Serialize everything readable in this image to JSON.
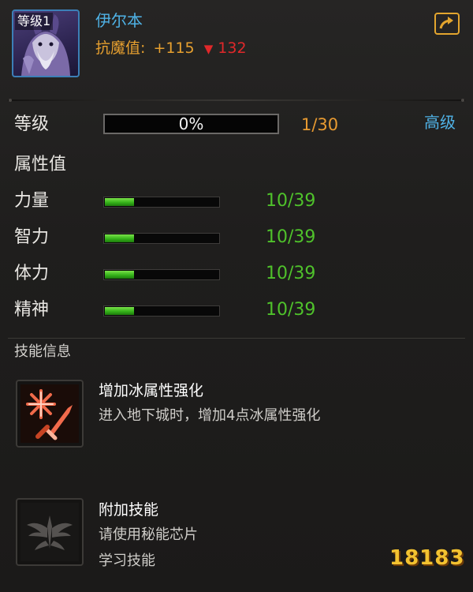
{
  "header": {
    "portrait_level": "等级1",
    "name": "伊尔本",
    "resist_label": "抗魔值:",
    "resist_plus": "+115",
    "resist_arrow": "▼",
    "resist_minus": "132",
    "export_icon": "share-export-icon"
  },
  "level": {
    "label": "等级",
    "percent_text": "0%",
    "progress": 0,
    "count": "1/30",
    "grade": "高级"
  },
  "attributes": {
    "title": "属性值",
    "items": [
      {
        "label": "力量",
        "value": "10/39",
        "fill": 0.256
      },
      {
        "label": "智力",
        "value": "10/39",
        "fill": 0.256
      },
      {
        "label": "体力",
        "value": "10/39",
        "fill": 0.256
      },
      {
        "label": "精神",
        "value": "10/39",
        "fill": 0.256
      }
    ]
  },
  "skills": {
    "title": "技能信息",
    "items": [
      {
        "icon": "ice-sword-icon",
        "name": "增加冰属性强化",
        "desc": [
          "进入地下城时，增加4点冰属性强化"
        ]
      },
      {
        "icon": "wing-emblem-icon",
        "name": "附加技能",
        "desc": [
          "请使用秘能芯片",
          "学习技能"
        ]
      }
    ]
  },
  "watermark": "18183",
  "colors": {
    "accent_blue": "#4fb2e6",
    "accent_orange": "#e79a31",
    "stat_green": "#4fc22b",
    "down_red": "#e0282a"
  }
}
